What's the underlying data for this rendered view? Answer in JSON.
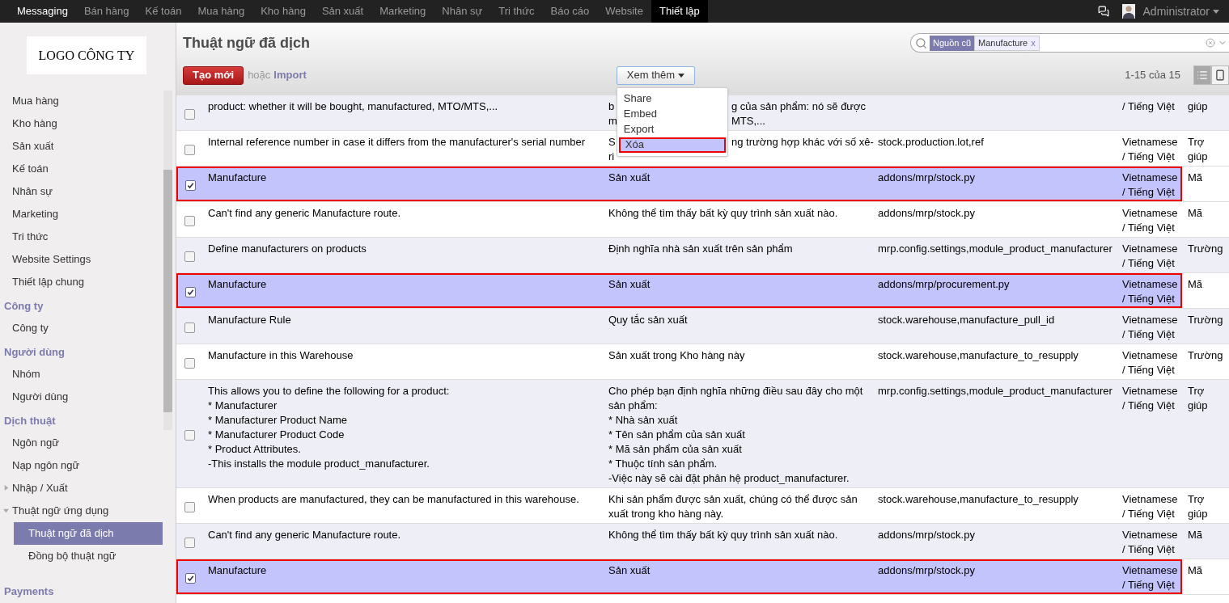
{
  "top_menu": [
    {
      "label": "Messaging",
      "selected": false,
      "bright": true
    },
    {
      "label": "Bán hàng",
      "selected": false,
      "bright": false
    },
    {
      "label": "Kế toán",
      "selected": false,
      "bright": false
    },
    {
      "label": "Mua hàng",
      "selected": false,
      "bright": false
    },
    {
      "label": "Kho hàng",
      "selected": false,
      "bright": false
    },
    {
      "label": "Sản xuất",
      "selected": false,
      "bright": false
    },
    {
      "label": "Marketing",
      "selected": false,
      "bright": false
    },
    {
      "label": "Nhân sự",
      "selected": false,
      "bright": false
    },
    {
      "label": "Tri thức",
      "selected": false,
      "bright": false
    },
    {
      "label": "Báo cáo",
      "selected": false,
      "bright": false
    },
    {
      "label": "Website",
      "selected": false,
      "bright": false
    },
    {
      "label": "Thiết lập",
      "selected": true,
      "bright": true
    }
  ],
  "user": {
    "name": "Administrator"
  },
  "logo": {
    "text": "LOGO CÔNG TY"
  },
  "sidebar": [
    {
      "items": [
        {
          "label": "Mua hàng",
          "selected": false
        },
        {
          "label": "Kho hàng",
          "selected": false
        },
        {
          "label": "Sản xuất",
          "selected": false
        },
        {
          "label": "Kế toán",
          "selected": false
        },
        {
          "label": "Nhân sự",
          "selected": false
        },
        {
          "label": "Marketing",
          "selected": false
        },
        {
          "label": "Tri thức",
          "selected": false
        },
        {
          "label": "Website Settings",
          "selected": false
        },
        {
          "label": "Thiết lập chung",
          "selected": false
        }
      ]
    },
    {
      "heading": "Công ty",
      "items": [
        {
          "label": "Công ty",
          "selected": false
        }
      ]
    },
    {
      "heading": "Người dùng",
      "items": [
        {
          "label": "Nhóm",
          "selected": false
        },
        {
          "label": "Người dùng",
          "selected": false
        }
      ]
    },
    {
      "heading": "Dịch thuật",
      "items": [
        {
          "label": "Ngôn ngữ",
          "selected": false
        },
        {
          "label": "Nạp ngôn ngữ",
          "selected": false
        },
        {
          "label": "Nhập / Xuất",
          "selected": false,
          "expanded": false
        },
        {
          "label": "Thuật ngữ ứng dụng",
          "selected": false,
          "expanded": true,
          "children": [
            {
              "label": "Thuật ngữ đã dịch",
              "selected": true
            },
            {
              "label": "Đồng bộ thuật ngữ",
              "selected": false
            }
          ]
        }
      ]
    },
    {
      "heading": "Payments"
    }
  ],
  "page": {
    "title": "Thuật ngữ đã dịch",
    "create_button": "Tạo mới",
    "or_text": "hoặc",
    "import_link": "Import",
    "more_button": "Xem thêm",
    "pager": "1-15 của 15"
  },
  "search": {
    "facet_label": "Nguồn cũ",
    "facet_value": "Manufacture",
    "facet_remove": "x"
  },
  "views": [
    {
      "kind": "list",
      "selected": true
    },
    {
      "kind": "form",
      "selected": false
    }
  ],
  "more_menu": [
    {
      "label": "Share",
      "highlighted": false
    },
    {
      "label": "Embed",
      "highlighted": false
    },
    {
      "label": "Export",
      "highlighted": false
    },
    {
      "label": "Xóa",
      "highlighted": true
    }
  ],
  "rows": [
    {
      "selected": false,
      "source": "product: whether it will be bought, manufactured, MTO/MTS,...",
      "translation_parts": [
        [
          "b",
          "g của sản phẩm: nó sẽ được"
        ],
        [
          "m",
          "MTS,..."
        ]
      ],
      "language": "/ Tiếng Việt",
      "type": "giúp"
    },
    {
      "selected": false,
      "source": "Internal reference number in case it differs from the manufacturer's serial number",
      "translation_parts": [
        [
          "S",
          "ng trường hợp khác với số xê-"
        ],
        [
          "ri"
        ]
      ],
      "location": "stock.production.lot,ref",
      "language": "Vietnamese\n/ Tiếng Việt",
      "type": "Trợ\ngiúp"
    },
    {
      "selected": true,
      "source": "Manufacture",
      "translation": "Sản xuất",
      "location": "addons/mrp/stock.py",
      "language": "Vietnamese\n/ Tiếng Việt",
      "type": "Mã"
    },
    {
      "selected": false,
      "source": "Can't find any generic Manufacture route.",
      "translation": "Không thể tìm thấy bất kỳ quy trình sản xuất nào.",
      "location": "addons/mrp/stock.py",
      "language": "Vietnamese\n/ Tiếng Việt",
      "type": "Mã"
    },
    {
      "selected": false,
      "source": "Define manufacturers on products",
      "translation": "Định nghĩa nhà sản xuất trên sản phẩm",
      "location": "mrp.config.settings,module_product_manufacturer",
      "language": "Vietnamese\n/ Tiếng Việt",
      "type": "Trường"
    },
    {
      "selected": true,
      "source": "Manufacture",
      "translation": "Sản xuất",
      "location": "addons/mrp/procurement.py",
      "language": "Vietnamese\n/ Tiếng Việt",
      "type": "Mã"
    },
    {
      "selected": false,
      "source": "Manufacture Rule",
      "translation": "Quy tắc sản xuất",
      "location": "stock.warehouse,manufacture_pull_id",
      "language": "Vietnamese\n/ Tiếng Việt",
      "type": "Trường"
    },
    {
      "selected": false,
      "source": "Manufacture in this Warehouse",
      "translation": "Sản xuất trong Kho hàng này",
      "location": "stock.warehouse,manufacture_to_resupply",
      "language": "Vietnamese\n/ Tiếng Việt",
      "type": "Trường"
    },
    {
      "selected": false,
      "source": "This allows you to define the following for a product:\n* Manufacturer\n* Manufacturer Product Name\n* Manufacturer Product Code\n* Product Attributes.\n-This installs the module product_manufacturer.",
      "translation": "Cho phép bạn định nghĩa những điều sau đây cho một sản phẩm:\n* Nhà sản xuất\n* Tên sản phẩm của sản xuất\n* Mã sản phẩm của sản xuất\n* Thuộc tính sản phẩm.\n-Việc này sẽ cài đặt phân hệ product_manufacturer.",
      "location": "mrp.config.settings,module_product_manufacturer",
      "language": "Vietnamese\n/ Tiếng Việt",
      "type": "Trợ\ngiúp"
    },
    {
      "selected": false,
      "source": "When products are manufactured, they can be manufactured in this warehouse.",
      "translation": "Khi sản phẩm được sản xuất, chúng có thể được sản xuất trong kho hàng này.",
      "location": "stock.warehouse,manufacture_to_resupply",
      "language": "Vietnamese\n/ Tiếng Việt",
      "type": "Trợ\ngiúp"
    },
    {
      "selected": false,
      "source": "Can't find any generic Manufacture route.",
      "translation": "Không thể tìm thấy bất kỳ quy trình sản xuất nào.",
      "location": "addons/mrp/stock.py",
      "language": "Vietnamese\n/ Tiếng Việt",
      "type": "Mã"
    },
    {
      "selected": true,
      "source": "Manufacture",
      "translation": "Sản xuất",
      "location": "addons/mrp/stock.py",
      "language": "Vietnamese\n/ Tiếng Việt",
      "type": "Mã"
    }
  ]
}
